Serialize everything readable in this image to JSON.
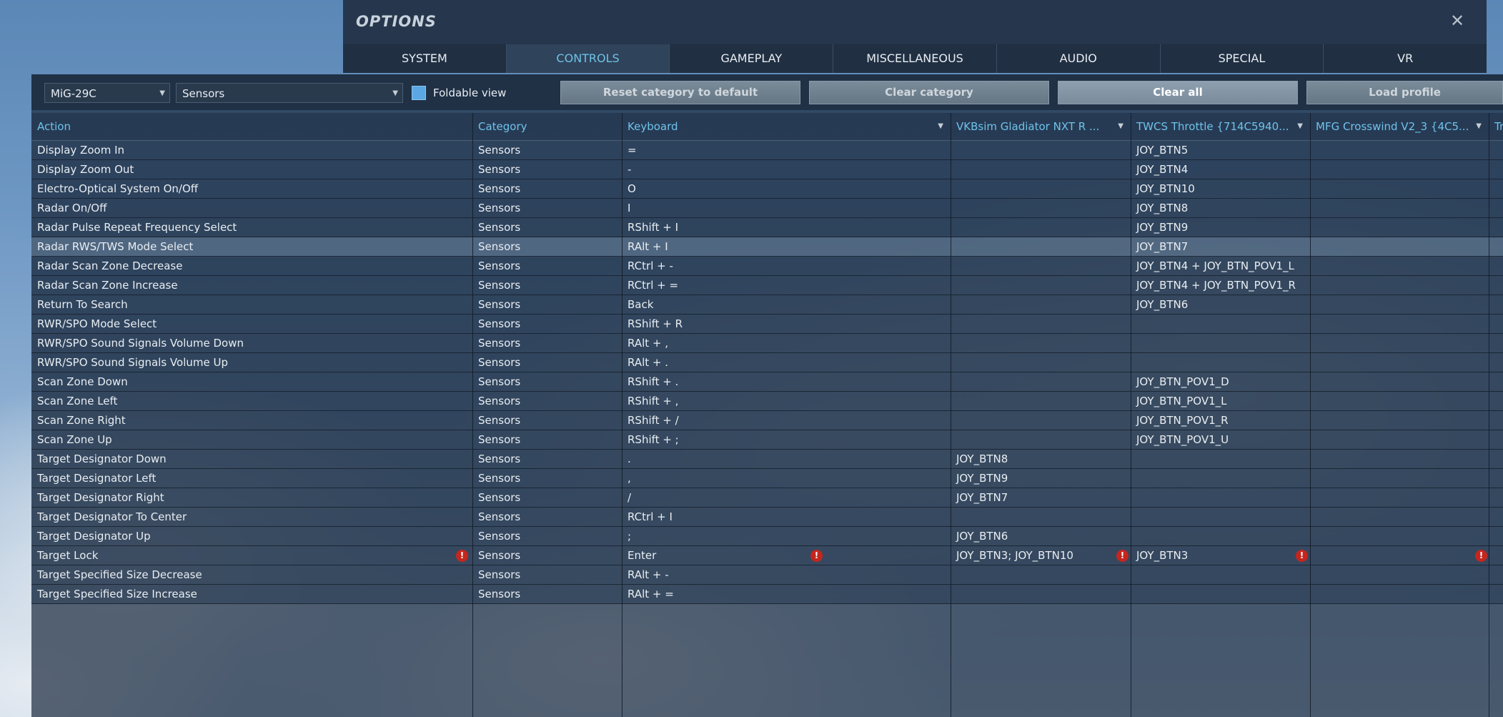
{
  "header": {
    "title": "OPTIONS",
    "close_glyph": "✕"
  },
  "tabs": [
    "SYSTEM",
    "CONTROLS",
    "GAMEPLAY",
    "MISCELLANEOUS",
    "AUDIO",
    "SPECIAL",
    "VR"
  ],
  "active_tab": "CONTROLS",
  "toolbar": {
    "aircraft_select": "MiG-29C",
    "category_select": "Sensors",
    "foldable_label": "Foldable view",
    "foldable_checked": true,
    "reset_label": "Reset category to default",
    "clear_category_label": "Clear category",
    "clear_all_label": "Clear all",
    "load_profile_label": "Load profile"
  },
  "table": {
    "columns": [
      {
        "label": "Action",
        "sortable": false
      },
      {
        "label": "Category",
        "sortable": false
      },
      {
        "label": "Keyboard",
        "sortable": true
      },
      {
        "label": "VKBsim Gladiator NXT R  ...",
        "sortable": true
      },
      {
        "label": "TWCS Throttle {714C5940...",
        "sortable": true
      },
      {
        "label": "MFG Crosswind V2_3 {4C5...",
        "sortable": true
      },
      {
        "label": "TrackIR",
        "sortable": false
      }
    ],
    "rows": [
      {
        "action": "Display Zoom In",
        "category": "Sensors",
        "keyboard": "=",
        "vkb": "",
        "twcs": "JOY_BTN5",
        "mfg": "",
        "trackir": ""
      },
      {
        "action": "Display Zoom Out",
        "category": "Sensors",
        "keyboard": "-",
        "vkb": "",
        "twcs": "JOY_BTN4",
        "mfg": "",
        "trackir": ""
      },
      {
        "action": "Electro-Optical System On/Off",
        "category": "Sensors",
        "keyboard": "O",
        "vkb": "",
        "twcs": "JOY_BTN10",
        "mfg": "",
        "trackir": ""
      },
      {
        "action": "Radar On/Off",
        "category": "Sensors",
        "keyboard": "I",
        "vkb": "",
        "twcs": "JOY_BTN8",
        "mfg": "",
        "trackir": ""
      },
      {
        "action": "Radar Pulse Repeat Frequency Select",
        "category": "Sensors",
        "keyboard": "RShift + I",
        "vkb": "",
        "twcs": "JOY_BTN9",
        "mfg": "",
        "trackir": ""
      },
      {
        "action": "Radar RWS/TWS Mode Select",
        "category": "Sensors",
        "keyboard": "RAlt + I",
        "vkb": "",
        "twcs": "JOY_BTN7",
        "mfg": "",
        "trackir": "",
        "selected": true
      },
      {
        "action": "Radar Scan Zone Decrease",
        "category": "Sensors",
        "keyboard": "RCtrl + -",
        "vkb": "",
        "twcs": "JOY_BTN4 + JOY_BTN_POV1_L",
        "mfg": "",
        "trackir": ""
      },
      {
        "action": "Radar Scan Zone Increase",
        "category": "Sensors",
        "keyboard": "RCtrl + =",
        "vkb": "",
        "twcs": "JOY_BTN4 + JOY_BTN_POV1_R",
        "mfg": "",
        "trackir": ""
      },
      {
        "action": "Return To Search",
        "category": "Sensors",
        "keyboard": "Back",
        "vkb": "",
        "twcs": "JOY_BTN6",
        "mfg": "",
        "trackir": ""
      },
      {
        "action": "RWR/SPO Mode Select",
        "category": "Sensors",
        "keyboard": "RShift + R",
        "vkb": "",
        "twcs": "",
        "mfg": "",
        "trackir": ""
      },
      {
        "action": "RWR/SPO Sound Signals Volume Down",
        "category": "Sensors",
        "keyboard": "RAlt + ,",
        "vkb": "",
        "twcs": "",
        "mfg": "",
        "trackir": ""
      },
      {
        "action": "RWR/SPO Sound Signals Volume Up",
        "category": "Sensors",
        "keyboard": "RAlt + .",
        "vkb": "",
        "twcs": "",
        "mfg": "",
        "trackir": ""
      },
      {
        "action": "Scan Zone Down",
        "category": "Sensors",
        "keyboard": "RShift + .",
        "vkb": "",
        "twcs": "JOY_BTN_POV1_D",
        "mfg": "",
        "trackir": ""
      },
      {
        "action": "Scan Zone Left",
        "category": "Sensors",
        "keyboard": "RShift + ,",
        "vkb": "",
        "twcs": "JOY_BTN_POV1_L",
        "mfg": "",
        "trackir": ""
      },
      {
        "action": "Scan Zone Right",
        "category": "Sensors",
        "keyboard": "RShift + /",
        "vkb": "",
        "twcs": "JOY_BTN_POV1_R",
        "mfg": "",
        "trackir": ""
      },
      {
        "action": "Scan Zone Up",
        "category": "Sensors",
        "keyboard": "RShift + ;",
        "vkb": "",
        "twcs": "JOY_BTN_POV1_U",
        "mfg": "",
        "trackir": ""
      },
      {
        "action": "Target Designator Down",
        "category": "Sensors",
        "keyboard": ".",
        "vkb": "JOY_BTN8",
        "twcs": "",
        "mfg": "",
        "trackir": ""
      },
      {
        "action": "Target Designator Left",
        "category": "Sensors",
        "keyboard": ",",
        "vkb": "JOY_BTN9",
        "twcs": "",
        "mfg": "",
        "trackir": ""
      },
      {
        "action": "Target Designator Right",
        "category": "Sensors",
        "keyboard": "/",
        "vkb": "JOY_BTN7",
        "twcs": "",
        "mfg": "",
        "trackir": ""
      },
      {
        "action": "Target Designator To Center",
        "category": "Sensors",
        "keyboard": "RCtrl + I",
        "vkb": "",
        "twcs": "",
        "mfg": "",
        "trackir": ""
      },
      {
        "action": "Target Designator Up",
        "category": "Sensors",
        "keyboard": ";",
        "vkb": "JOY_BTN6",
        "twcs": "",
        "mfg": "",
        "trackir": ""
      },
      {
        "action": "Target Lock",
        "category": "Sensors",
        "keyboard": "Enter",
        "vkb": "JOY_BTN3; JOY_BTN10",
        "twcs": "JOY_BTN3",
        "mfg": "",
        "trackir": "",
        "conflict": true
      },
      {
        "action": "Target Specified Size Decrease",
        "category": "Sensors",
        "keyboard": "RAlt + -",
        "vkb": "",
        "twcs": "",
        "mfg": "",
        "trackir": ""
      },
      {
        "action": "Target Specified Size Increase",
        "category": "Sensors",
        "keyboard": "RAlt + =",
        "vkb": "",
        "twcs": "",
        "mfg": "",
        "trackir": ""
      }
    ]
  },
  "icons": {
    "dropdown_arrow": "▼",
    "warning": "!"
  },
  "colors": {
    "accent": "#6ec3ea",
    "warning": "#c4261e",
    "checkbox": "#5aa7e4"
  }
}
